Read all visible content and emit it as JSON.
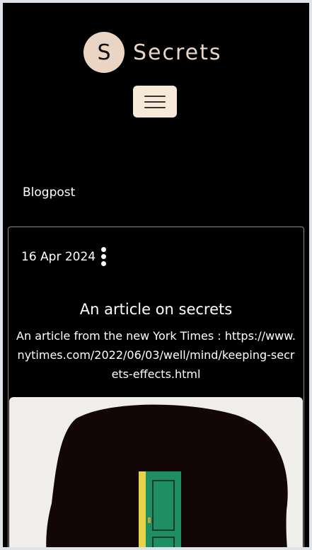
{
  "brand": {
    "logo_letter": "S",
    "name": "Secrets"
  },
  "nav": {
    "menu_icon": "hamburger-icon"
  },
  "section": {
    "label": "Blogpost"
  },
  "post": {
    "date": "16 Apr 2024",
    "title": "An article on secrets",
    "description": "An article from the new York Times : https://www.nytimes.com/2022/06/03/well/mind/keeping-secrets-effects.html",
    "image_icon": "open-door-illustration"
  },
  "colors": {
    "background": "#000000",
    "accent": "#ead4c3",
    "button_bg": "#f6e9d8",
    "door_green": "#1f8e63",
    "door_frame": "#e9d24a"
  }
}
